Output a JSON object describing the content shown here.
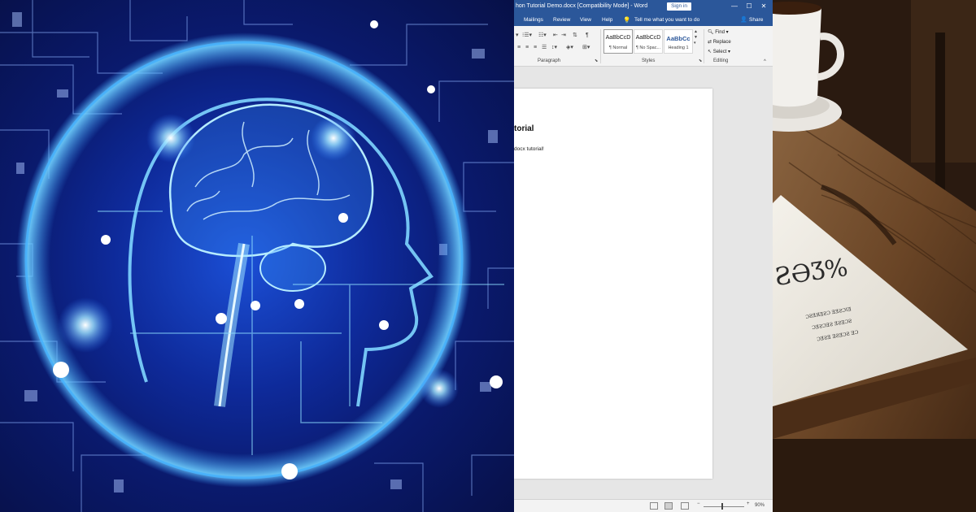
{
  "word": {
    "title": "hon Tutorial Demo.docx [Compatibility Mode] - Word",
    "sign_in": "Sign in",
    "window_controls": [
      "—",
      "☐",
      "✕"
    ],
    "tabs": [
      "Mailings",
      "Review",
      "View",
      "Help"
    ],
    "tell_me": "Tell me what you want to do",
    "share": "Share",
    "ribbon": {
      "paragraph_label": "Paragraph",
      "styles_label": "Styles",
      "editing_label": "Editing",
      "styles": [
        {
          "sample": "AaBbCcD",
          "name": "¶ Normal"
        },
        {
          "sample": "AaBbCcD",
          "name": "¶ No Spac..."
        },
        {
          "sample": "AaBbCc",
          "name": "Heading 1"
        }
      ],
      "find": "Find",
      "replace": "Replace",
      "select": "Select"
    },
    "document": {
      "heading": "torial",
      "body": "docx tutorial!"
    },
    "status": {
      "zoom": "90%"
    }
  },
  "photo": {
    "paper_big": "ƧƏƷ%",
    "paper_lines": [
      "ƆƧƎЯƎƧƆ ƎƎƧƆƖƎ",
      "ƆƎƧƆƎƧ ƎƧƎƆƧ",
      "ƆƎƧƎ ƎƧƎƆƧ ƎƆ"
    ]
  },
  "colors": {
    "word_blue": "#2b579a"
  },
  "icons": {
    "tell_me": "lightbulb-icon",
    "share": "person-icon",
    "find": "magnifier-icon",
    "replace": "replace-icon",
    "select": "select-arrow-icon"
  }
}
